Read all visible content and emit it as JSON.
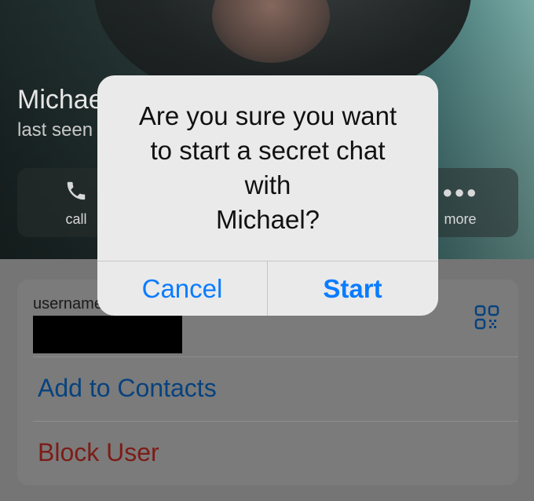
{
  "profile": {
    "name": "Michael",
    "status": "last seen recently",
    "actions": {
      "call_label": "call",
      "more_label": "more"
    }
  },
  "info": {
    "username_label": "username",
    "add_contacts": "Add to Contacts",
    "block_user": "Block User"
  },
  "alert": {
    "message": "Are you sure you want\nto start a secret chat\nwith\nMichael?",
    "cancel_label": "Cancel",
    "start_label": "Start"
  },
  "colors": {
    "accent": "#0a7cff",
    "destructive": "#7c1c17"
  }
}
